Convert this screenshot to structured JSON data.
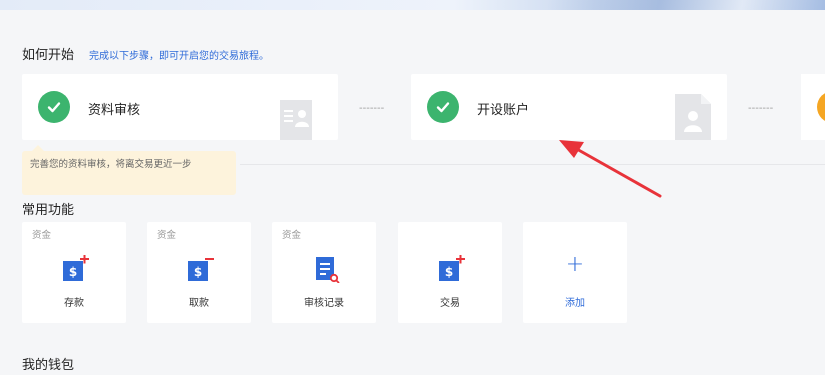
{
  "how_to_start": {
    "title": "如何开始",
    "subtitle": "完成以下步骤，即可开启您的交易旅程。",
    "steps": [
      {
        "label": "资料审核",
        "status": "done"
      },
      {
        "label": "开设账户",
        "status": "done"
      }
    ],
    "connector": "-------",
    "tooltip": "完善您的资料审核，将离交易更近一步"
  },
  "common_functions": {
    "title": "常用功能",
    "items": [
      {
        "tag": "资金",
        "label": "存款",
        "icon": "deposit-icon"
      },
      {
        "tag": "资金",
        "label": "取款",
        "icon": "withdraw-icon"
      },
      {
        "tag": "资金",
        "label": "审核记录",
        "icon": "review-record-icon"
      },
      {
        "tag": "",
        "label": "交易",
        "icon": "trade-icon"
      },
      {
        "tag": "",
        "label": "添加",
        "icon": "plus-icon"
      }
    ]
  },
  "wallet": {
    "title": "我的钱包"
  },
  "colors": {
    "accent": "#2f6bd8",
    "success": "#3cb46e",
    "warning": "#f5a623",
    "annotation": "#e8333a",
    "tooltip_bg": "#fdf3dc"
  }
}
